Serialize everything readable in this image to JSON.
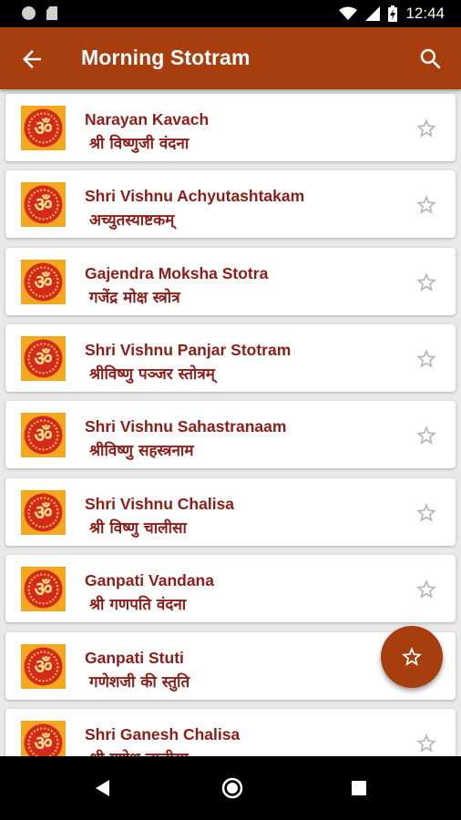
{
  "status_bar": {
    "time": "12:44"
  },
  "app_bar": {
    "title": "Morning Stotram"
  },
  "items": [
    {
      "title": "Narayan Kavach",
      "subtitle": "श्री विष्णुजी वंदना"
    },
    {
      "title": "Shri Vishnu Achyutashtakam",
      "subtitle": "अच्युतस्याष्टकम्"
    },
    {
      "title": "Gajendra Moksha Stotra",
      "subtitle": "गजेंद्र मोक्ष स्त्रोत्र"
    },
    {
      "title": "Shri Vishnu Panjar Stotram",
      "subtitle": "श्रीविष्णु पञ्जर स्तोत्रम्"
    },
    {
      "title": "Shri Vishnu Sahastranaam",
      "subtitle": "श्रीविष्णु सहस्त्रनाम"
    },
    {
      "title": "Shri Vishnu Chalisa",
      "subtitle": "श्री विष्णु चालीसा"
    },
    {
      "title": "Ganpati Vandana",
      "subtitle": "श्री गणपति वंदना"
    },
    {
      "title": "Ganpati Stuti",
      "subtitle": "गणेशजी की स्तुति"
    },
    {
      "title": "Shri Ganesh Chalisa",
      "subtitle": "श्री गणेश चालीसा"
    }
  ],
  "icons": {
    "back": "arrow-back-icon",
    "search": "search-icon",
    "favorite": "star-outline-icon",
    "fab": "star-outline-icon",
    "thumbnail": "om-icon"
  },
  "colors": {
    "primary": "#a83d0e",
    "item_text": "#8e1d17",
    "thumb_bg": "#f4a81f"
  }
}
